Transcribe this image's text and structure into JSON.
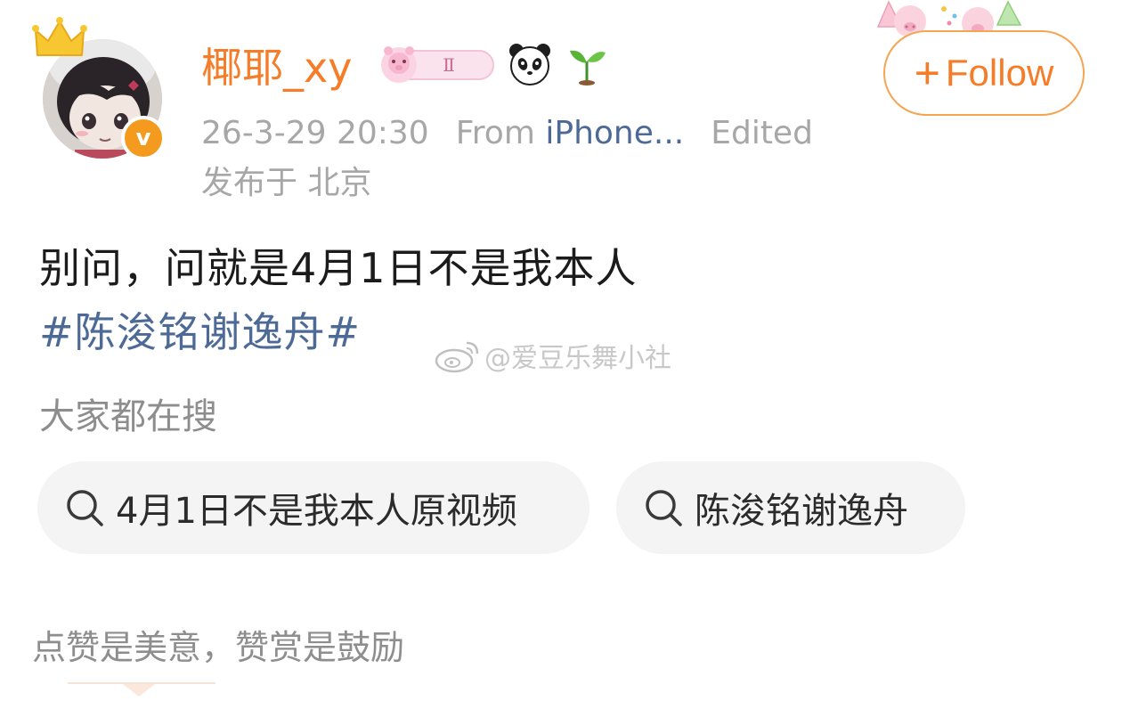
{
  "header": {
    "username": "椰耶_xy",
    "medal_level": "Ⅱ",
    "badges": [
      "vip-medal-icon",
      "panda-icon",
      "sprout-icon"
    ],
    "timestamp": "26-3-29 20:30",
    "source_prefix": "From",
    "source_name": "iPhone...",
    "edited_label": "Edited",
    "location": "发布于 北京",
    "follow_label": "Follow",
    "follow_icon": "plus-icon"
  },
  "post": {
    "text": "别问，问就是4月1日不是我本人",
    "hashtag": "#陈浚铭谢逸舟#",
    "watermark": "@爱豆乐舞小社"
  },
  "search": {
    "section_title": "大家都在搜",
    "chips": [
      {
        "label": "4月1日不是我本人原视频",
        "icon": "search-icon"
      },
      {
        "label": "陈浚铭谢逸舟",
        "icon": "search-icon"
      }
    ]
  },
  "footer": {
    "tip": "点赞是美意，赞赏是鼓励"
  },
  "colors": {
    "accent": "#f57d29",
    "link": "#4d6a96",
    "muted": "#a7a7a7",
    "verified": "#f39a1f",
    "chip_bg": "#f4f4f4"
  }
}
